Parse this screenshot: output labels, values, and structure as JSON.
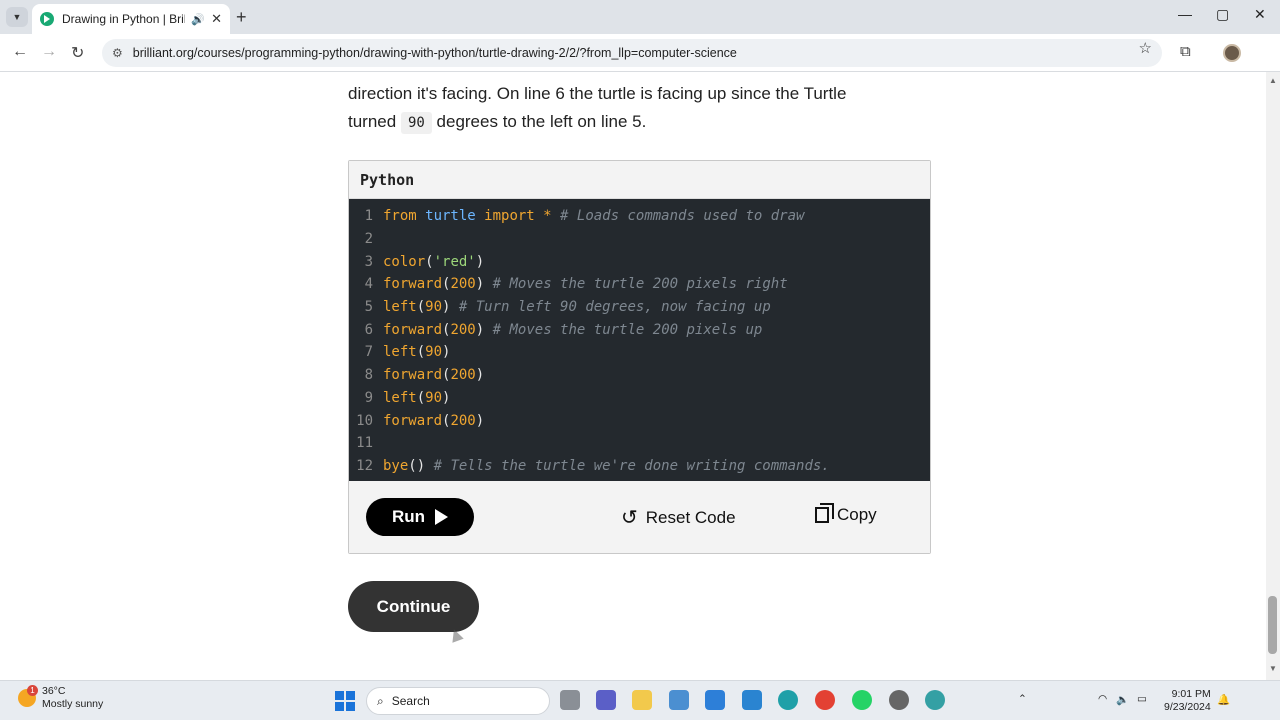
{
  "browser": {
    "tab_title": "Drawing in Python | Brilliant",
    "url": "brilliant.org/courses/programming-python/drawing-with-python/turtle-drawing-2/2/?from_llp=computer-science",
    "new_tab": "+",
    "minimize": "—",
    "maximize": "▢",
    "close": "✕"
  },
  "lesson": {
    "prose_line1": "direction it's facing. On line 6 the turtle is facing up since the Turtle",
    "prose_line2_before": "turned",
    "prose_inline_code": "90",
    "prose_line2_after": "degrees to the left on line 5."
  },
  "code_block": {
    "language": "Python",
    "lines": [
      {
        "n": "1",
        "tokens": [
          {
            "t": "from",
            "c": "kw"
          },
          {
            "t": " turtle",
            "c": "mod"
          },
          {
            "t": " import",
            "c": "kw"
          },
          {
            "t": " *",
            "c": "kw"
          },
          {
            "t": " # Loads commands used to draw",
            "c": "cm"
          }
        ]
      },
      {
        "n": "2",
        "tokens": []
      },
      {
        "n": "3",
        "tokens": [
          {
            "t": "color",
            "c": "fn"
          },
          {
            "t": "(",
            "c": "pn"
          },
          {
            "t": "'red'",
            "c": "str"
          },
          {
            "t": ")",
            "c": "pn"
          }
        ]
      },
      {
        "n": "4",
        "tokens": [
          {
            "t": "forward",
            "c": "fn"
          },
          {
            "t": "(",
            "c": "pn"
          },
          {
            "t": "200",
            "c": "num"
          },
          {
            "t": ")",
            "c": "pn"
          },
          {
            "t": " # Moves the turtle 200 pixels right",
            "c": "cm"
          }
        ]
      },
      {
        "n": "5",
        "tokens": [
          {
            "t": "left",
            "c": "fn"
          },
          {
            "t": "(",
            "c": "pn"
          },
          {
            "t": "90",
            "c": "num"
          },
          {
            "t": ")",
            "c": "pn"
          },
          {
            "t": " # Turn left 90 degrees, now facing up",
            "c": "cm"
          }
        ]
      },
      {
        "n": "6",
        "tokens": [
          {
            "t": "forward",
            "c": "fn"
          },
          {
            "t": "(",
            "c": "pn"
          },
          {
            "t": "200",
            "c": "num"
          },
          {
            "t": ")",
            "c": "pn"
          },
          {
            "t": " # Moves the turtle 200 pixels up",
            "c": "cm"
          }
        ]
      },
      {
        "n": "7",
        "tokens": [
          {
            "t": "left",
            "c": "fn"
          },
          {
            "t": "(",
            "c": "pn"
          },
          {
            "t": "90",
            "c": "num"
          },
          {
            "t": ")",
            "c": "pn"
          }
        ]
      },
      {
        "n": "8",
        "tokens": [
          {
            "t": "forward",
            "c": "fn"
          },
          {
            "t": "(",
            "c": "pn"
          },
          {
            "t": "200",
            "c": "num"
          },
          {
            "t": ")",
            "c": "pn"
          }
        ]
      },
      {
        "n": "9",
        "tokens": [
          {
            "t": "left",
            "c": "fn"
          },
          {
            "t": "(",
            "c": "pn"
          },
          {
            "t": "90",
            "c": "num"
          },
          {
            "t": ")",
            "c": "pn"
          }
        ]
      },
      {
        "n": "10",
        "tokens": [
          {
            "t": "forward",
            "c": "fn"
          },
          {
            "t": "(",
            "c": "pn"
          },
          {
            "t": "200",
            "c": "num"
          },
          {
            "t": ")",
            "c": "pn"
          }
        ]
      },
      {
        "n": "11",
        "tokens": []
      },
      {
        "n": "12",
        "tokens": [
          {
            "t": "bye",
            "c": "fn"
          },
          {
            "t": "()",
            "c": "pn"
          },
          {
            "t": " # Tells the turtle we're done writing commands.",
            "c": "cm"
          }
        ]
      }
    ],
    "run_label": "Run",
    "reset_label": "Reset Code",
    "copy_label": "Copy"
  },
  "continue_label": "Continue",
  "taskbar": {
    "temperature": "36°C",
    "weather": "Mostly sunny",
    "weather_badge": "1",
    "search_placeholder": "Search",
    "time": "9:01 PM",
    "date": "9/23/2024"
  },
  "colors": {
    "editor_bg": "#24292e",
    "keyword": "#f0a630",
    "module": "#6cb6ff",
    "string": "#9cd67a",
    "comment": "#7e8790",
    "button_dark": "#000000",
    "brand_green": "#19a974"
  }
}
